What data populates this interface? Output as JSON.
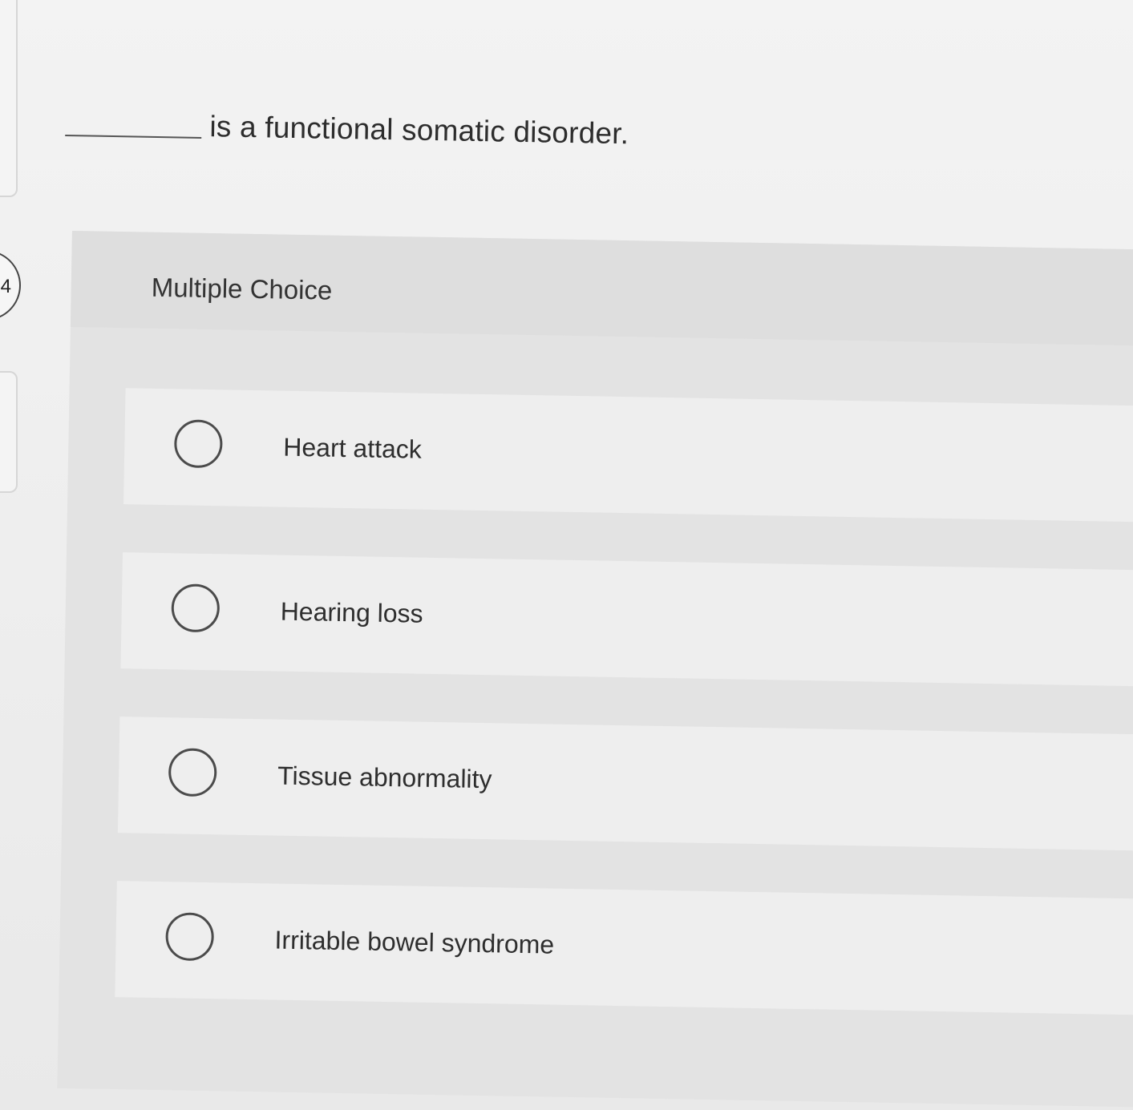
{
  "question": {
    "number": "4",
    "blank": "",
    "text": "is a functional somatic disorder."
  },
  "answer_panel": {
    "title": "Multiple Choice",
    "options": [
      {
        "label": "Heart attack",
        "selected": false
      },
      {
        "label": "Hearing loss",
        "selected": false
      },
      {
        "label": "Tissue abnormality",
        "selected": false
      },
      {
        "label": "Irritable bowel syndrome",
        "selected": false
      }
    ]
  }
}
